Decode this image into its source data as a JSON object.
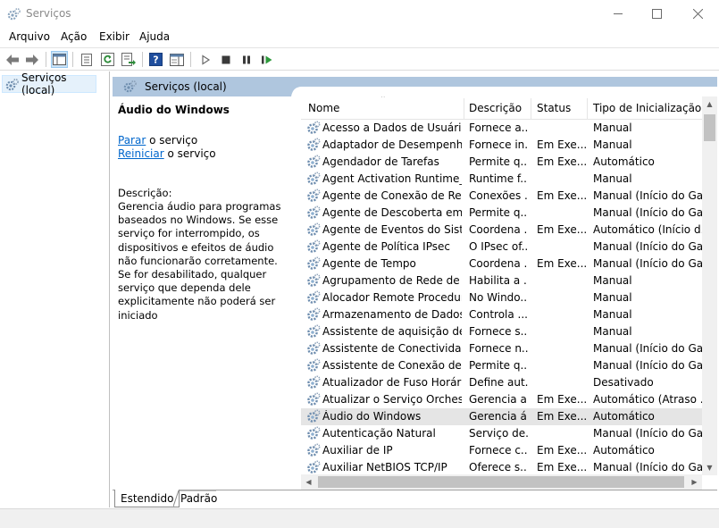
{
  "window": {
    "title": "Serviços",
    "icon": "gear-services-icon"
  },
  "menu": [
    "Arquivo",
    "Ação",
    "Exibir",
    "Ajuda"
  ],
  "toolbar": {
    "icons": [
      "back-arrow-icon",
      "forward-arrow-icon",
      "show-hide-console-tree-icon",
      "properties-icon",
      "refresh-icon",
      "export-list-icon",
      "help-icon",
      "show-action-pane-icon",
      "start-service-icon",
      "stop-service-icon",
      "pause-service-icon",
      "restart-service-icon"
    ]
  },
  "tree": {
    "item_label": "Serviços (local)"
  },
  "main": {
    "header_title": "Serviços (local)"
  },
  "details": {
    "service_title": "Áudio do Windows",
    "stop_link": "Parar",
    "stop_suffix": " o serviço",
    "restart_link": "Reiniciar",
    "restart_suffix": " o serviço",
    "description_label": "Descrição:",
    "description_text": "Gerencia áudio para programas baseados no Windows. Se esse serviço for interrompido, os dispositivos e efeitos de áudio não funcionarão corretamente. Se for desabilitado, qualquer serviço que dependa dele explicitamente não poderá ser iniciado"
  },
  "list": {
    "columns": {
      "name": "Nome",
      "description": "Descrição",
      "status": "Status",
      "startup_type": "Tipo de Inicialização"
    },
    "rows": [
      {
        "name": "Acesso a Dados de Usuário_...",
        "description": "Fornece a...",
        "status": "",
        "startup_type": "Manual"
      },
      {
        "name": "Adaptador de Desempenho...",
        "description": "Fornece in...",
        "status": "Em Exe...",
        "startup_type": "Manual"
      },
      {
        "name": "Agendador de Tarefas",
        "description": "Permite q...",
        "status": "Em Exe...",
        "startup_type": "Automático"
      },
      {
        "name": "Agent Activation Runtime_...",
        "description": "Runtime f...",
        "status": "",
        "startup_type": "Manual"
      },
      {
        "name": "Agente de Conexão de Rede",
        "description": "Conexões ...",
        "status": "Em Exe...",
        "startup_type": "Manual (Início do Ga..."
      },
      {
        "name": "Agente de Descoberta em S...",
        "description": "Permite q...",
        "status": "",
        "startup_type": "Manual (Início do Ga..."
      },
      {
        "name": "Agente de Eventos do Siste...",
        "description": "Coordena ...",
        "status": "Em Exe...",
        "startup_type": "Automático (Início d..."
      },
      {
        "name": "Agente de Política IPsec",
        "description": "O IPsec of...",
        "status": "",
        "startup_type": "Manual (Início do Ga..."
      },
      {
        "name": "Agente de Tempo",
        "description": "Coordena ...",
        "status": "Em Exe...",
        "startup_type": "Manual (Início do Ga..."
      },
      {
        "name": "Agrupamento de Rede de Par",
        "description": "Habilita a ...",
        "status": "",
        "startup_type": "Manual"
      },
      {
        "name": "Alocador Remote Procedur...",
        "description": "No Windo...",
        "status": "",
        "startup_type": "Manual"
      },
      {
        "name": "Armazenamento de Dados ...",
        "description": "Controla ...",
        "status": "",
        "startup_type": "Manual"
      },
      {
        "name": "Assistente de aquisição de i...",
        "description": "Fornece s...",
        "status": "",
        "startup_type": "Manual"
      },
      {
        "name": "Assistente de Conectividad...",
        "description": "Fornece n...",
        "status": "",
        "startup_type": "Manual (Início do Ga..."
      },
      {
        "name": "Assistente de Conexão de C...",
        "description": "Permite q...",
        "status": "",
        "startup_type": "Manual (Início do Ga..."
      },
      {
        "name": "Atualizador de Fuso Horário...",
        "description": "Define aut...",
        "status": "",
        "startup_type": "Desativado"
      },
      {
        "name": "Atualizar o Serviço Orchestr...",
        "description": "Gerencia a...",
        "status": "Em Exe...",
        "startup_type": "Automático (Atraso ..."
      },
      {
        "name": "Áudio do Windows",
        "description": "Gerencia á...",
        "status": "Em Exe...",
        "startup_type": "Automático",
        "selected": true
      },
      {
        "name": "Autenticação Natural",
        "description": "Serviço de...",
        "status": "",
        "startup_type": "Manual (Início do Ga..."
      },
      {
        "name": "Auxiliar de IP",
        "description": "Fornece c...",
        "status": "Em Exe...",
        "startup_type": "Automático"
      },
      {
        "name": "Auxiliar NetBIOS TCP/IP",
        "description": "Oferece s...",
        "status": "Em Exe...",
        "startup_type": "Manual (Início do Ga..."
      }
    ]
  },
  "tabs": [
    "Estendido",
    "Padrão"
  ],
  "colors": {
    "link": "#0066cc",
    "header_band": "#afc6de",
    "selected_row": "#e5e5e5"
  }
}
